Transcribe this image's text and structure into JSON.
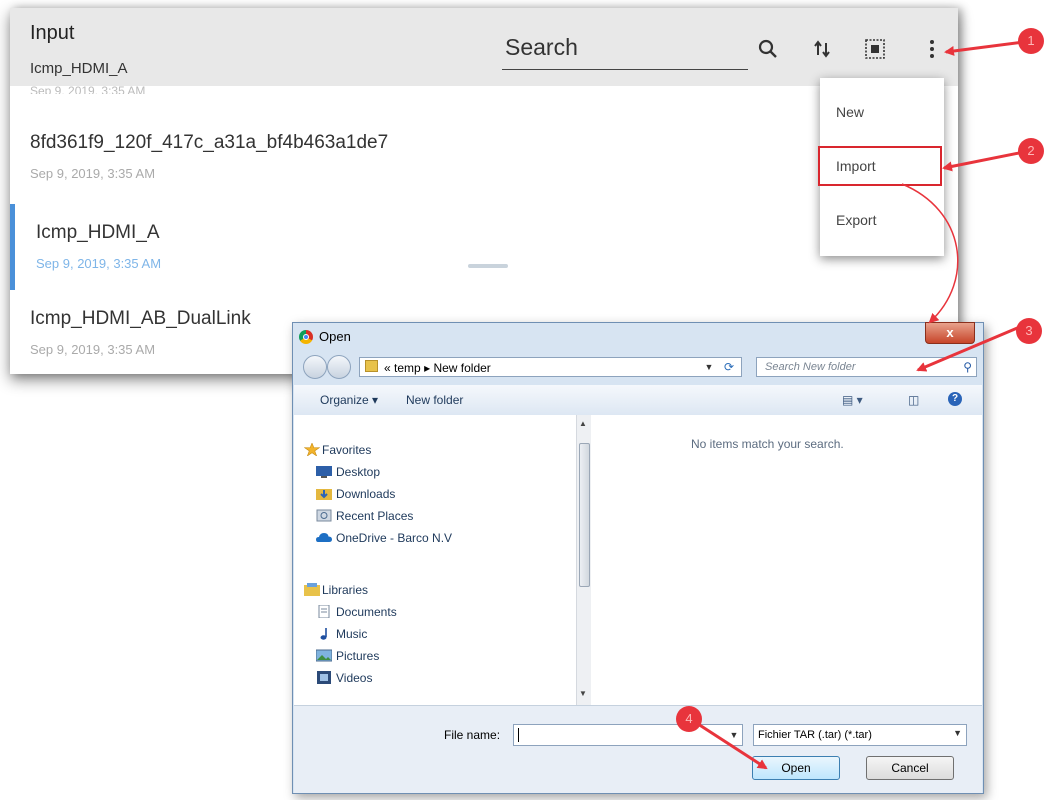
{
  "app": {
    "title": "Input",
    "subtitle": "Icmp_HDMI_A",
    "search_label": "Search",
    "cut_off_row": "Sep 9, 2019, 3:35 AM",
    "items": [
      {
        "title": "8fd361f9_120f_417c_a31a_bf4b463a1de7",
        "date": "Sep 9, 2019, 3:35 AM"
      },
      {
        "title": "Icmp_HDMI_A",
        "date": "Sep 9, 2019, 3:35 AM"
      },
      {
        "title": "Icmp_HDMI_AB_DualLink",
        "date": "Sep 9, 2019, 3:35 AM"
      }
    ],
    "icons": [
      "search-icon",
      "sort-icon",
      "select-all-icon",
      "more-vert-icon"
    ]
  },
  "menu": {
    "items": [
      "New",
      "Import",
      "Export"
    ]
  },
  "dialog": {
    "title": "Open",
    "close_glyph": "x",
    "address": {
      "prefix": "«",
      "path1": "temp",
      "sep": "▸",
      "path2": "New folder"
    },
    "search_placeholder": "Search New folder",
    "toolbar": {
      "organize": "Organize ▾",
      "new_folder": "New folder"
    },
    "nav": {
      "favorites_header": "Favorites",
      "favorites": [
        "Desktop",
        "Downloads",
        "Recent Places",
        "OneDrive - Barco N.V"
      ],
      "libraries_header": "Libraries",
      "libraries": [
        "Documents",
        "Music",
        "Pictures",
        "Videos"
      ]
    },
    "empty_message": "No items match your search.",
    "file_name_label": "File name:",
    "file_name_value": "",
    "file_type": "Fichier TAR (.tar) (*.tar)",
    "open_button": "Open",
    "cancel_button": "Cancel"
  },
  "callouts": [
    "1",
    "2",
    "3",
    "4"
  ],
  "colors": {
    "callout": "#e8343c",
    "selected_accent": "#4a90d9",
    "highlight_box": "#d9262e"
  }
}
